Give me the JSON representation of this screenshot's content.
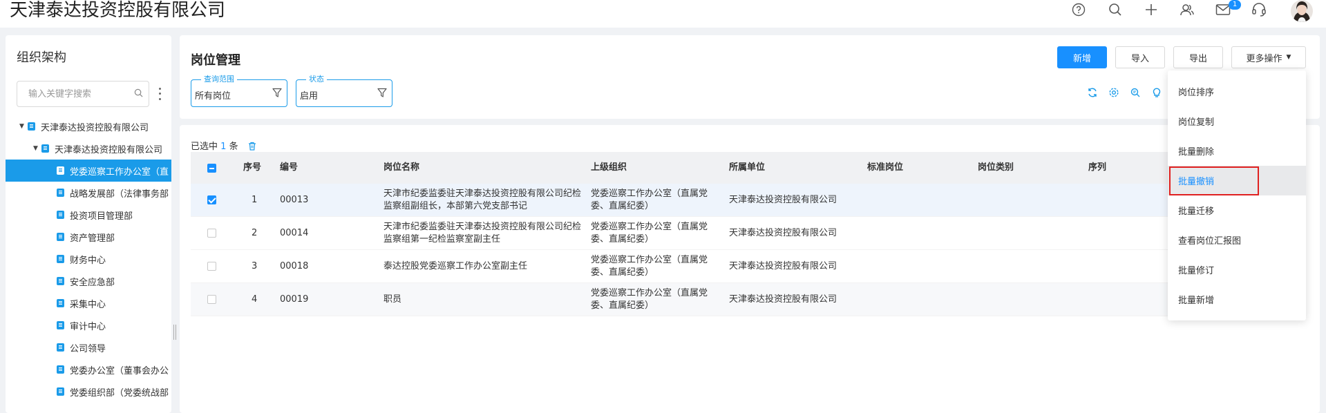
{
  "app": {
    "title": "天津泰达投资控股有限公司",
    "notification_count": "1"
  },
  "header": {
    "icons": [
      "help-icon",
      "search-icon",
      "plus-icon",
      "users-icon",
      "mail-icon",
      "headset-icon",
      "user-avatar"
    ]
  },
  "sidebar": {
    "title": "组织架构",
    "search_placeholder": "输入关键字搜索",
    "tree": [
      {
        "label": "天津泰达投资控股有限公司",
        "level": 0,
        "expanded": true,
        "selected": false
      },
      {
        "label": "天津泰达投资控股有限公司",
        "level": 1,
        "expanded": true,
        "selected": false
      },
      {
        "label": "党委巡察工作办公室（直",
        "level": 2,
        "selected": true
      },
      {
        "label": "战略发展部（法律事务部",
        "level": 2,
        "selected": false
      },
      {
        "label": "投资项目管理部",
        "level": 2,
        "selected": false
      },
      {
        "label": "资产管理部",
        "level": 2,
        "selected": false
      },
      {
        "label": "财务中心",
        "level": 2,
        "selected": false
      },
      {
        "label": "安全应急部",
        "level": 2,
        "selected": false
      },
      {
        "label": "采集中心",
        "level": 2,
        "selected": false
      },
      {
        "label": "审计中心",
        "level": 2,
        "selected": false
      },
      {
        "label": "公司领导",
        "level": 2,
        "selected": false
      },
      {
        "label": "党委办公室（董事会办公",
        "level": 2,
        "selected": false
      },
      {
        "label": "党委组织部（党委统战部",
        "level": 2,
        "selected": false
      }
    ]
  },
  "page": {
    "title": "岗位管理",
    "buttons": {
      "add": "新增",
      "import": "导入",
      "export": "导出",
      "more": "更多操作"
    },
    "filters": [
      {
        "label": "查询范围",
        "value": "所有岗位"
      },
      {
        "label": "状态",
        "value": "启用"
      }
    ],
    "selection": {
      "prefix": "已选中",
      "count": "1",
      "suffix": "条"
    }
  },
  "table": {
    "headers": {
      "seq": "序号",
      "code": "编号",
      "name": "岗位名称",
      "parent": "上级组织",
      "unit": "所属单位",
      "std": "标准岗位",
      "category": "岗位类别",
      "order": "序列"
    },
    "rows": [
      {
        "seq": "1",
        "code": "00013",
        "name": "天津市纪委监委驻天津泰达投资控股有限公司纪检监察组副组长，本部第六党支部书记",
        "parent": "党委巡察工作办公室（直属党委、直属纪委）",
        "unit": "天津泰达投资控股有限公司",
        "checked": true
      },
      {
        "seq": "2",
        "code": "00014",
        "name": "天津市纪委监委驻天津泰达投资控股有限公司纪检监察组第一纪检监察室副主任",
        "parent": "党委巡察工作办公室（直属党委、直属纪委）",
        "unit": "天津泰达投资控股有限公司",
        "checked": false
      },
      {
        "seq": "3",
        "code": "00018",
        "name": "泰达控股党委巡察工作办公室副主任",
        "parent": "党委巡察工作办公室（直属党委、直属纪委）",
        "unit": "天津泰达投资控股有限公司",
        "checked": false
      },
      {
        "seq": "4",
        "code": "00019",
        "name": "职员",
        "parent": "党委巡察工作办公室（直属党委、直属纪委）",
        "unit": "天津泰达投资控股有限公司",
        "checked": false
      }
    ]
  },
  "more_menu": {
    "items": [
      "岗位排序",
      "岗位复制",
      "批量删除",
      "批量撤销",
      "批量迁移",
      "查看岗位汇报图",
      "批量修订",
      "批量新增"
    ],
    "hovered_item": "批量撤销"
  },
  "colors": {
    "primary": "#1890ff",
    "highlight_box": "#e0201f",
    "selected_tree": "#1a9be9"
  }
}
